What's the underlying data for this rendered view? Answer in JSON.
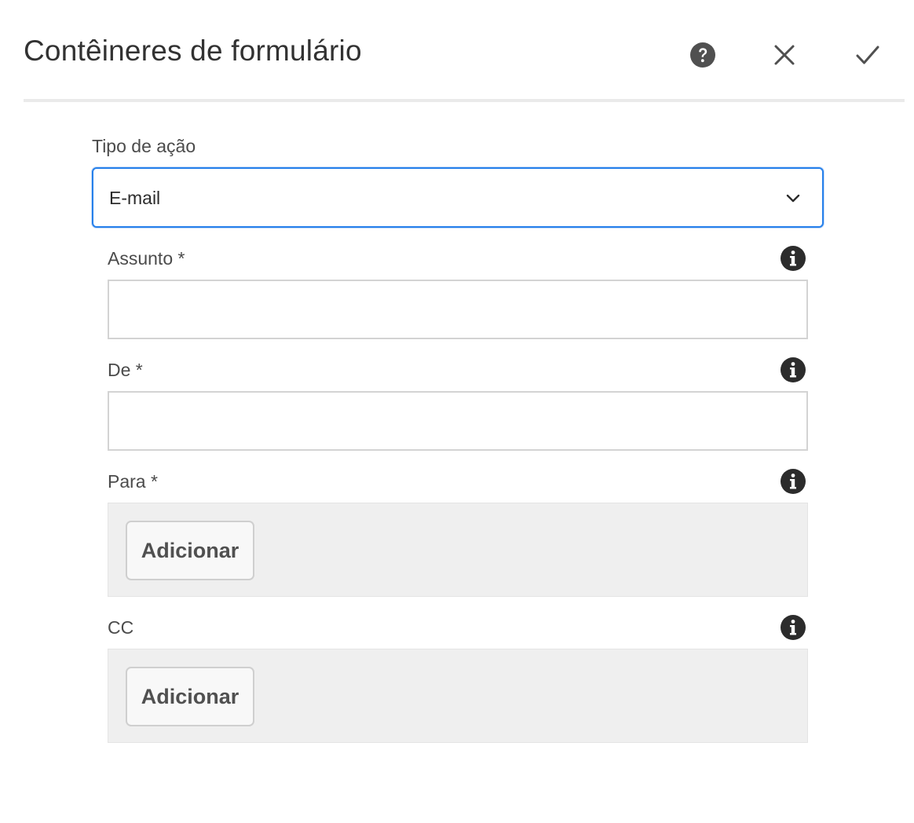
{
  "dialog": {
    "title": "Contêineres de formulário",
    "actions": {
      "help_icon": "help-circle-icon",
      "close_icon": "close-icon",
      "done_icon": "checkmark-icon"
    }
  },
  "form": {
    "action_type": {
      "label": "Tipo de ação",
      "selected": "E-mail",
      "icon": "chevron-down-icon",
      "accent_color": "#2680eb"
    },
    "subject": {
      "label": "Assunto *",
      "value": "",
      "info_icon": "info-icon"
    },
    "from": {
      "label": "De *",
      "value": "",
      "info_icon": "info-icon"
    },
    "to": {
      "label": "Para *",
      "add_label": "Adicionar",
      "info_icon": "info-icon"
    },
    "cc": {
      "label": "CC",
      "add_label": "Adicionar",
      "info_icon": "info-icon"
    }
  }
}
